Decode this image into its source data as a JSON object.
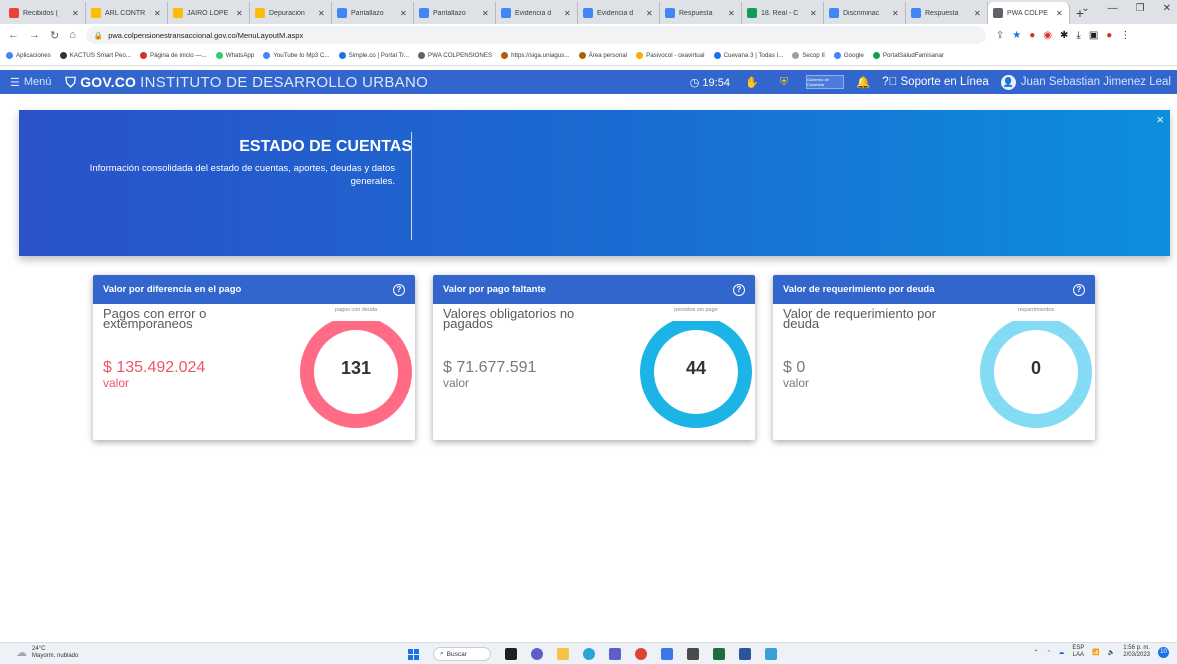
{
  "browser": {
    "tabs": [
      {
        "label": "Recibidos (",
        "color": "#ea4335"
      },
      {
        "label": "ARL CONTR",
        "color": "#fbbc04"
      },
      {
        "label": "JAIRO LÓPE",
        "color": "#fbbc04"
      },
      {
        "label": "Depuración",
        "color": "#fbbc04"
      },
      {
        "label": "Pantallazo",
        "color": "#4285f4"
      },
      {
        "label": "Pantallazo",
        "color": "#4285f4"
      },
      {
        "label": "Evidencia d",
        "color": "#4285f4"
      },
      {
        "label": "Evidencia d",
        "color": "#4285f4"
      },
      {
        "label": "Respuesta",
        "color": "#4285f4"
      },
      {
        "label": "18. Real - C",
        "color": "#0f9d58"
      },
      {
        "label": "Discriminac",
        "color": "#4285f4"
      },
      {
        "label": "Respuesta",
        "color": "#4285f4"
      },
      {
        "label": "PWA COLPE",
        "color": "#5f6368",
        "active": true
      }
    ],
    "new_tab": "+",
    "url": "pwa.colpensionestransaccional.gov.co/MenuLayoutM.aspx",
    "bookmarks": [
      {
        "label": "Aplicaciones",
        "color": "#4285f4"
      },
      {
        "label": "KACTUS Smart Peo...",
        "color": "#333333"
      },
      {
        "label": "Página de inicio —...",
        "color": "#d93025"
      },
      {
        "label": "WhatsApp",
        "color": "#25d366"
      },
      {
        "label": "YouTube to Mp3 C...",
        "color": "#4285f4"
      },
      {
        "label": "Simple.co | Portal Tr...",
        "color": "#1a73e8"
      },
      {
        "label": "PWA COLPENSIONES",
        "color": "#5f6368"
      },
      {
        "label": "https://siga.uniagus...",
        "color": "#b06000"
      },
      {
        "label": "Área personal",
        "color": "#b06000"
      },
      {
        "label": "Pasivocol - ceavirtual",
        "color": "#f9ab00"
      },
      {
        "label": "Cuevana 3 | Todas l...",
        "color": "#1a73e8"
      },
      {
        "label": "Secop II",
        "color": "#9aa0a6"
      },
      {
        "label": "Google",
        "color": "#4285f4"
      },
      {
        "label": "PortalSaludFamisanar",
        "color": "#0f9d58"
      }
    ]
  },
  "header": {
    "menu_label": "Menú",
    "gov_logo": "GOV.CO",
    "institution": "INSTITUTO DE DESARROLLO URBANO",
    "time": "19:54",
    "support": "Soporte en Línea",
    "user": "Juan Sebastian Jimenez Leal",
    "gobierno_logo": "Gobierno de Colombia"
  },
  "banner": {
    "title": "ESTADO DE CUENTAS",
    "description": "Información consolidada del estado de cuentas, aportes, deudas y datos generales.",
    "close": "×"
  },
  "cards": [
    {
      "title": "Valor por diferencia en el pago",
      "subtitle": "Pagos con error o extemporaneos",
      "caption": "pagos con deuda",
      "value": "$ 135.492.024",
      "unit": "valor",
      "count": "131",
      "ring_color": "#ff6b84",
      "accent": "red"
    },
    {
      "title": "Valor por pago faltante",
      "subtitle": "Valores obligatorios no pagados",
      "caption": "periodos sin pago",
      "value": "$ 71.677.591",
      "unit": "valor",
      "count": "44",
      "ring_color": "#1cb4e6",
      "accent": "gray"
    },
    {
      "title": "Valor de requerimiento por deuda",
      "subtitle": "Valor de requerimiento por deuda",
      "caption": "requerimientos",
      "value": "$ 0",
      "unit": "valor",
      "count": "0",
      "ring_color": "#83dcf4",
      "accent": "gray"
    }
  ],
  "taskbar": {
    "temperature": "24°C",
    "weather": "Mayorm. nublado",
    "search": "Buscar",
    "lang": "ESP",
    "lang_sub": "LAA",
    "time": "1:56 p. m.",
    "date": "2/03/2023",
    "notifications": "10"
  }
}
